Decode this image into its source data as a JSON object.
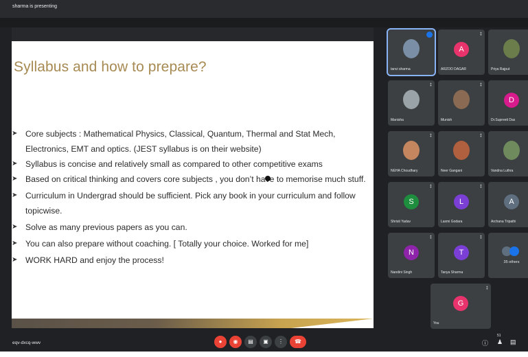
{
  "meeting": {
    "presenting_text": "sharma is presenting",
    "meeting_code": "eqv-dxcq-wwv"
  },
  "slide": {
    "title": "Syllabus and how to prepare?",
    "bullets": [
      "Core subjects : Mathematical Physics, Classical, Quantum, Thermal and Stat Mech, Electronics, EMT and optics. (JEST syllabus is on their website)",
      "Syllabus is concise and relatively small as compared to other competitive exams",
      "Based on critical thinking and covers core subjects , you don’t have to memorise much stuff.",
      "Curriculum in  Undergrad should be sufficient. Pick any book in your curriculum and follow topicwise.",
      "Solve as many previous papers as you can.",
      "You can also prepare without coaching.  [ Totally your choice. Worked for me]",
      "WORK HARD and enjoy the process!"
    ]
  },
  "participants": [
    {
      "name": "tanvi sharma",
      "type": "photo",
      "color": "#7a8fa6",
      "active": true
    },
    {
      "name": "ARZOO DAGAR",
      "type": "letter",
      "letter": "A",
      "color": "#e8336d"
    },
    {
      "name": "Priya Rajput",
      "type": "photo",
      "color": "#6b7d4a"
    },
    {
      "name": "Manisha",
      "type": "photo",
      "color": "#9aa3a8"
    },
    {
      "name": "Munish",
      "type": "photo",
      "color": "#8a6a52"
    },
    {
      "name": "Dr.Supreeti Das",
      "type": "letter",
      "letter": "D",
      "color": "#d81b8c"
    },
    {
      "name": "NEHA Choudhary",
      "type": "photo",
      "color": "#c4865f"
    },
    {
      "name": "Neer Gangani",
      "type": "photo",
      "color": "#b0603e"
    },
    {
      "name": "Vandna Luthra",
      "type": "photo",
      "color": "#6f8a5c"
    },
    {
      "name": "Shristi Yadav",
      "type": "letter",
      "letter": "S",
      "color": "#1e8e3e"
    },
    {
      "name": "Laxmi Godara",
      "type": "letter",
      "letter": "L",
      "color": "#7b3fd6"
    },
    {
      "name": "Archana Tripathi",
      "type": "letter",
      "letter": "A",
      "color": "#5f6f80"
    },
    {
      "name": "Nandini Singh",
      "type": "letter",
      "letter": "N",
      "color": "#8e24aa"
    },
    {
      "name": "Tanya Sharma",
      "type": "letter",
      "letter": "T",
      "color": "#7b3fd6"
    },
    {
      "name": "35 others",
      "type": "others"
    },
    {
      "name": "You",
      "type": "letter",
      "letter": "G",
      "color": "#e8336d"
    }
  ],
  "icons": {
    "mic_off": "mic-off-icon",
    "camera_off": "camera-off-icon",
    "captions": "captions-icon",
    "present": "present-icon",
    "more": "more-options-icon",
    "hangup": "hang-up-icon",
    "info": "info-icon",
    "people": "people-icon",
    "chat": "chat-icon"
  },
  "colors": {
    "title": "#a78a52",
    "red_control": "#ea4335",
    "active_outline": "#8ab4f8"
  },
  "people_count_badge": "51"
}
